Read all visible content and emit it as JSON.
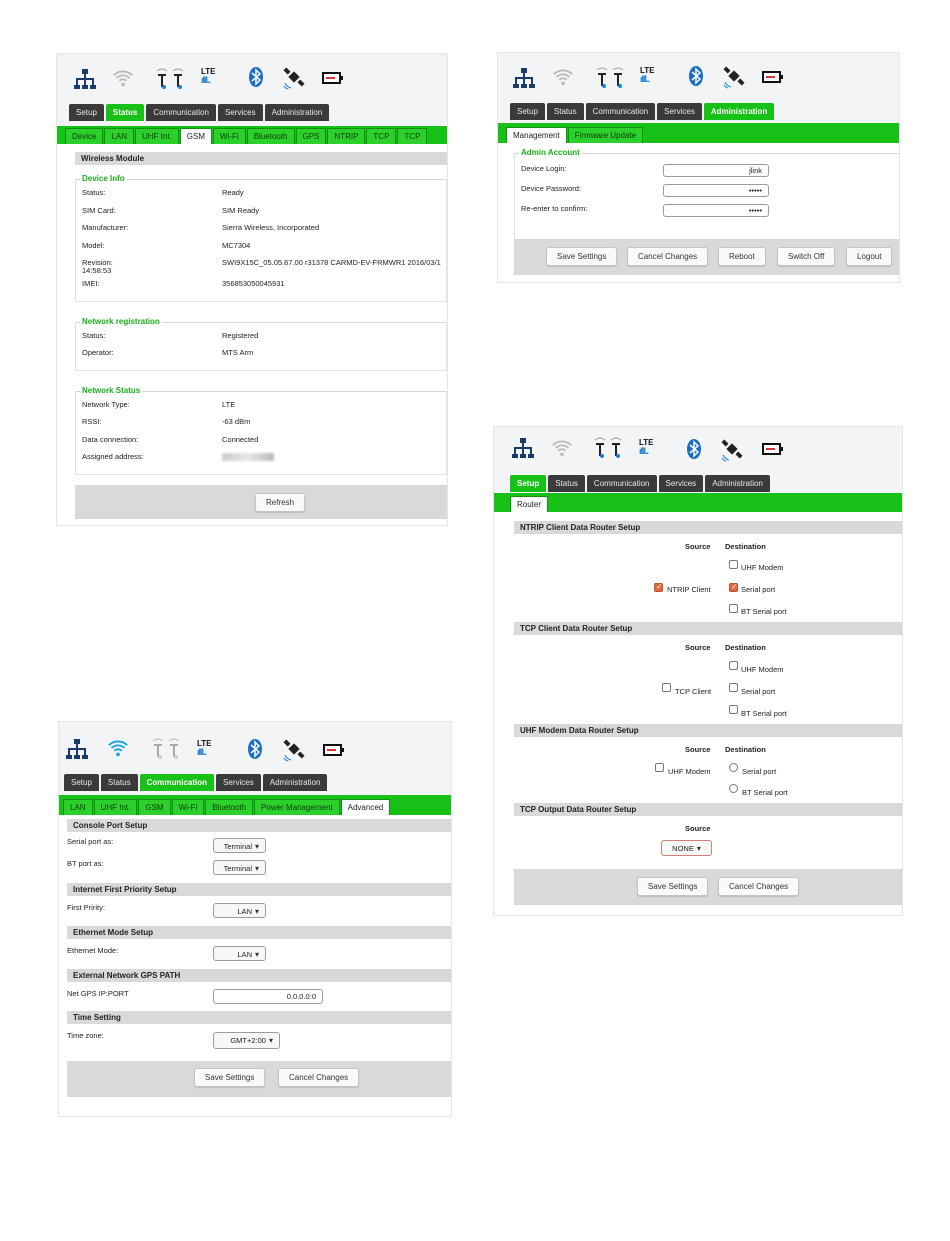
{
  "colors": {
    "accent_green": "#17c117",
    "tab_dark": "#3a3a3a",
    "section_gray": "#d9d9d9",
    "wifi_blue": "#1a7fd4",
    "checkbox_on": "#e0683e"
  },
  "icons": [
    "lan-icon",
    "wifi-icon",
    "uhf-antenna-icon",
    "lte-signal-icon",
    "bluetooth-icon",
    "gps-satellite-icon",
    "battery-icon"
  ],
  "lte_label": "LTE",
  "main_tabs": {
    "setup": "Setup",
    "status": "Status",
    "communication": "Communication",
    "services": "Services",
    "administration": "Administration"
  },
  "panel1": {
    "subtabs": [
      "Device",
      "LAN",
      "UHF Int.",
      "GSM",
      "Wi-Fi",
      "Bluetooth",
      "GPS",
      "NTRIP",
      "TCP",
      "TCP"
    ],
    "section_title": "Wireless Module",
    "device_info": {
      "legend": "Device Info",
      "rows": [
        {
          "k": "Status:",
          "v": "Ready"
        },
        {
          "k": "SIM Card:",
          "v": "SIM Ready"
        },
        {
          "k": "Manufacturer:",
          "v": "Sierra Wireless, Incorporated"
        },
        {
          "k": "Model:",
          "v": "MC7304"
        },
        {
          "k": "Revision:",
          "v": "SWI9X15C_05.05.67.00 r31378 CARMD-EV-FRMWR1 2016/03/1"
        },
        {
          "k": "IMEI:",
          "v": "356853050045931"
        }
      ],
      "revision_time": "14:58:53"
    },
    "network_registration": {
      "legend": "Network registration",
      "rows": [
        {
          "k": "Status:",
          "v": "Registered"
        },
        {
          "k": "Operator:",
          "v": "MTS Arm"
        }
      ]
    },
    "network_status": {
      "legend": "Network Status",
      "rows": [
        {
          "k": "Network Type:",
          "v": "LTE"
        },
        {
          "k": "RSSI:",
          "v": "-63 dBm"
        },
        {
          "k": "Data connection:",
          "v": "Connected"
        },
        {
          "k": "Assigned address:",
          "v": ""
        }
      ]
    },
    "refresh_label": "Refresh"
  },
  "panel2": {
    "subtabs": [
      "Management",
      "Firmware Update"
    ],
    "legend": "Admin Account",
    "fields": [
      {
        "label": "Device Login:",
        "value": "jlink"
      },
      {
        "label": "Device Password:",
        "value": "•••••"
      },
      {
        "label": "Re-enter to confirm:",
        "value": "•••••"
      }
    ],
    "buttons": {
      "save": "Save Settings",
      "cancel": "Cancel Changes",
      "reboot": "Reboot",
      "switch_off": "Switch Off",
      "logout": "Logout"
    }
  },
  "panel3": {
    "subtabs": [
      "LAN",
      "UHF Int.",
      "GSM",
      "Wi-Fi",
      "Bluetooth",
      "Power Management",
      "Advanced"
    ],
    "console": {
      "title": "Console Port Setup",
      "serial_label": "Serial port as:",
      "serial_value": "Terminal",
      "bt_label": "BT port as:",
      "bt_value": "Terminal"
    },
    "internet": {
      "title": "Internet First Priority Setup",
      "label": "First Pririty:",
      "value": "LAN"
    },
    "ethernet": {
      "title": "Ethernet Mode Setup",
      "label": "Ethernet Mode:",
      "value": "LAN"
    },
    "gps": {
      "title": "External Network GPS PATH",
      "label": "Net GPS IP:PORT",
      "value": "0.0.0.0:0"
    },
    "time": {
      "title": "Time Setting",
      "label": "Time zone:",
      "value": "GMT+2:00"
    },
    "buttons": {
      "save": "Save Settings",
      "cancel": "Cancel Changes"
    }
  },
  "panel4": {
    "subtabs": [
      "Router"
    ],
    "source_label": "Source",
    "destination_label": "Destination",
    "ntrip": {
      "title": "NTRIP Client Data Router Setup",
      "source": "NTRIP Client",
      "dest": [
        "UHF Modem",
        "Serial port",
        "BT Serial port"
      ]
    },
    "tcp": {
      "title": "TCP Client Data Router Setup",
      "source": "TCP Client",
      "dest": [
        "UHF Modem",
        "Serial port",
        "BT Serial port"
      ]
    },
    "uhf": {
      "title": "UHF Modem Data Router Setup",
      "source": "UHF Modem",
      "dest": [
        "Serial port",
        "BT Serial port"
      ]
    },
    "tcp_out": {
      "title": "TCP Output Data Router Setup",
      "value": "NONE"
    },
    "buttons": {
      "save": "Save Settings",
      "cancel": "Cancel Changes"
    }
  }
}
